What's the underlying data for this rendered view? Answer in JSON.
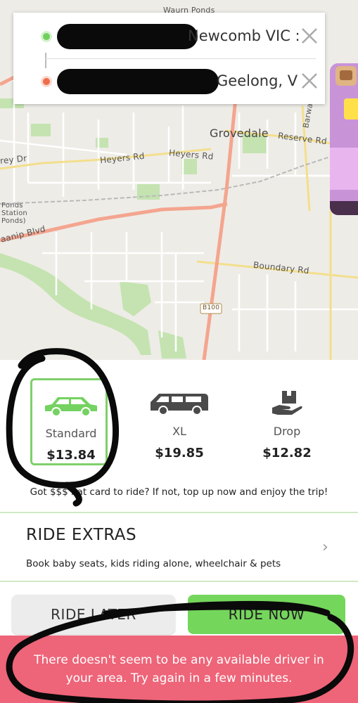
{
  "map": {
    "labels": {
      "waurn_ponds": "Waurn Ponds",
      "grovedale": "Grovedale",
      "reserve_rd": "Reserve Rd",
      "barwa": "Barwa",
      "heyers_rd_1": "Heyers Rd",
      "heyers_rd_2": "Heyers Rd",
      "rey_dr": "rey Dr",
      "ponds_station": "Ponds\nStation\nPonds)",
      "aanip_blvd": "aanip Blvd",
      "boundary_rd": "Boundary Rd",
      "route_shield": "B100"
    }
  },
  "route": {
    "pickup": {
      "text": "Newcomb VIC :"
    },
    "dropoff": {
      "text": "Geelong, V"
    }
  },
  "vehicles": [
    {
      "name": "Standard",
      "price": "$13.84",
      "icon": "car-icon",
      "selected": true
    },
    {
      "name": "XL",
      "price": "$19.85",
      "icon": "van-icon",
      "selected": false
    },
    {
      "name": "Drop",
      "price": "$12.82",
      "icon": "package-hand-icon",
      "selected": false
    }
  ],
  "topup_note": "Got $$$    hat card to ride? If not, top up now and enjoy the trip!",
  "extras": {
    "title": "RIDE EXTRAS",
    "description": "Book baby seats, kids riding alone, wheelchair & pets"
  },
  "actions": {
    "ride_later": "RIDE LATER",
    "ride_now": "RIDE NOW"
  },
  "toast": {
    "message": "There doesn't seem to be any available driver in your area. Try again in a few minutes."
  },
  "colors": {
    "accent_green": "#75d65c",
    "pickup_dot": "#6fd15c",
    "dropoff_dot": "#ef6d4c",
    "error_toast": "#ee6478",
    "map_road_major": "#f4a58f"
  }
}
